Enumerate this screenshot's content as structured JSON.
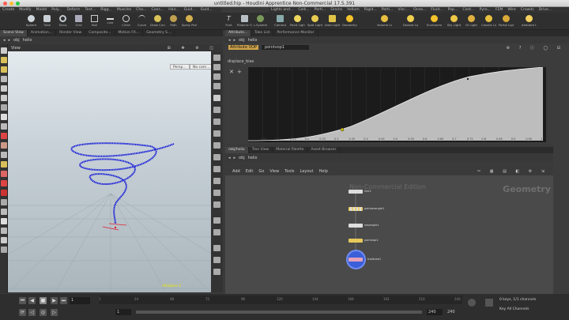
{
  "window": {
    "title": "untitled.hip - Houdini Apprentice Non-Commercial 17.5.391"
  },
  "shelf_tabs": [
    "Create",
    "Modify",
    "Model",
    "Poly...",
    "Deform",
    "Text...",
    "Rigg...",
    "Muscles",
    "Cha...",
    "Cons...",
    "Hair...",
    "Guid...",
    "Guid..."
  ],
  "shelf_tools": [
    "Sphere",
    "Tube",
    "Torus",
    "Grid",
    "Null",
    "Line",
    "Circle",
    "Curve",
    "Draw Curve",
    "Path",
    "Spray Paint",
    "Font",
    "Platonic Solids",
    "L-System",
    "Metaball",
    "File"
  ],
  "light_tabs": [
    "Lights and...",
    "Colli...",
    "Parti...",
    "Grains",
    "Vellum",
    "Rigid...",
    "Parti...",
    "Visc...",
    "Ocea...",
    "Fluid...",
    "Pop...",
    "Cont...",
    "Pyro...",
    "FEM",
    "Wire",
    "Crowds",
    "Drive..."
  ],
  "light_tools": [
    "Camera",
    "Point Light",
    "Spot Light",
    "Area Light",
    "Geometry Light",
    "Volume Light",
    "Distant Light",
    "Environment Light",
    "Sky Light",
    "GI Light",
    "Caustic Light",
    "Portal Light",
    "Ambient Light"
  ],
  "left_tabs": [
    "Scene View",
    "Animation...",
    "Render View",
    "Composite...",
    "Motion FX...",
    "Geometry S..."
  ],
  "left_path": "obj",
  "left_node": "helix",
  "viewport": {
    "menu": "View",
    "persp": "Persp...",
    "cam": "No cam...",
    "corner_text": "Alt/Option Z"
  },
  "right_tabs": [
    "Attribute...",
    "Take List",
    "Performance Monitor"
  ],
  "params": {
    "type_label": "Attribute VOP",
    "node_name": "pointvop1",
    "param_name": "displace_bias"
  },
  "graph_ticks": [
    "0",
    "0.05",
    "0.1",
    "0.15",
    "0.2",
    "0.25",
    "0.3",
    "0.35",
    "0.4",
    "0.45",
    "0.5",
    "0.55",
    "0.6",
    "0.65",
    "0.7",
    "0.75",
    "0.8",
    "0.85",
    "0.9",
    "0.95",
    "1"
  ],
  "net_tabs": [
    "/obj/helix",
    "Tree View",
    "Material Palette",
    "Asset Browser"
  ],
  "net_path": "obj",
  "net_node": "helix",
  "net_menu": [
    "Add",
    "Edit",
    "Go",
    "View",
    "Tools",
    "Layout",
    "Help"
  ],
  "net_title": "Non-Commercial Edition",
  "net_context": "Geometry",
  "nodes": [
    {
      "label": "line1"
    },
    {
      "label": "pointwrangle1"
    },
    {
      "label": "resample1"
    },
    {
      "label": "pointvop1"
    },
    {
      "label": "trailtube1"
    }
  ],
  "timeline": {
    "frame": "1",
    "start": "1",
    "end": "240",
    "end2": "240",
    "ticks": [
      "1",
      "24",
      "48",
      "72",
      "96",
      "120",
      "144",
      "168",
      "192",
      "216",
      "240"
    ],
    "keys": "0 keys, 1/1 channels",
    "key_all": "Key All Channels"
  },
  "colors": {
    "accent": "#f4c22b",
    "helix": "#1a1fd8",
    "curve": "#bdbdbd"
  }
}
